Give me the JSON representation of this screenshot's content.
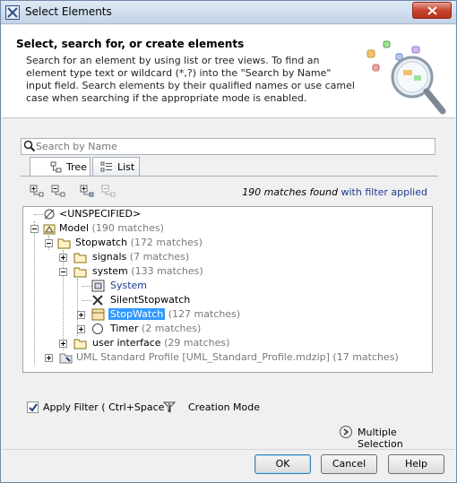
{
  "window": {
    "title": "Select Elements"
  },
  "header": {
    "title": "Select, search for, or create elements",
    "description": "Search for an element by using list or tree views. To find an element type text or wildcard (*,?) into the \"Search by Name\" input field. Search elements by their qualified names or use camel case when searching if the appropriate mode is enabled."
  },
  "search": {
    "placeholder": "Search by Name",
    "value": ""
  },
  "tabs": [
    {
      "label": "Tree",
      "active": true
    },
    {
      "label": "List",
      "active": false
    }
  ],
  "toolbar": {
    "matches_count": "190 matches found",
    "filter_text": "with filter applied"
  },
  "tree": {
    "rows": [
      {
        "label": "<UNSPECIFIED>",
        "count": ""
      },
      {
        "label": "Model",
        "count": "(190 matches)"
      },
      {
        "label": "Stopwatch",
        "count": "(172 matches)"
      },
      {
        "label": "signals",
        "count": "(7 matches)"
      },
      {
        "label": "system",
        "count": "(133 matches)"
      },
      {
        "label": "System",
        "count": ""
      },
      {
        "label": "SilentStopwatch",
        "count": ""
      },
      {
        "label": "StopWatch",
        "count": "(127 matches)"
      },
      {
        "label": "Timer",
        "count": "(2 matches)"
      },
      {
        "label": "user interface",
        "count": "(29 matches)"
      },
      {
        "label": "UML Standard Profile [UML_Standard_Profile.mdzip]",
        "count": "(17 matches)"
      }
    ]
  },
  "options": {
    "apply_filter_label": "Apply Filter ( Ctrl+Space )",
    "apply_filter_checked": true,
    "creation_mode_label": "Creation Mode",
    "multiple_selection_label": "Multiple Selection"
  },
  "buttons": {
    "ok": "OK",
    "cancel": "Cancel",
    "help": "Help"
  },
  "colors": {
    "selection": "#3399ff",
    "link": "#1a3c8f",
    "muted": "#7a7a7a"
  }
}
